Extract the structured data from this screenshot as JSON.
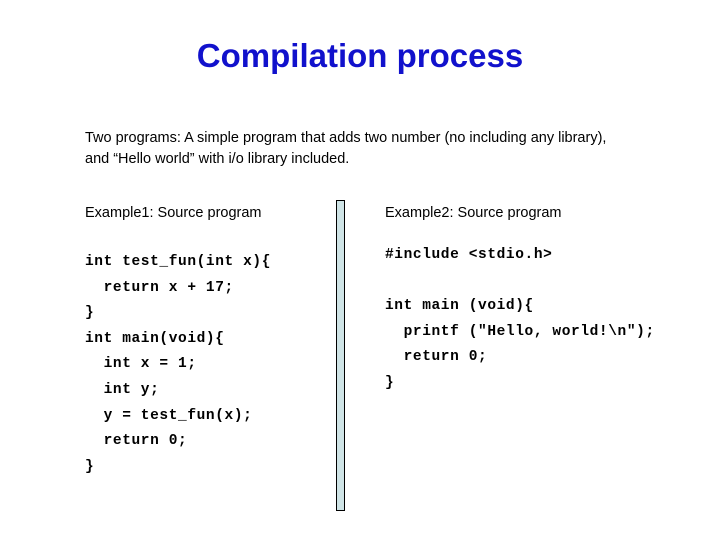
{
  "slide": {
    "title": "Compilation process",
    "title_color": "#1111cc",
    "background_color": "#ffffff",
    "intro": "Two programs: A simple program that adds two number (no including any library), and “Hello world” with i/o library included."
  },
  "divider": {
    "name": "vertical-divider-bar",
    "fill_color": "#cfe4e6",
    "border_color": "#000000"
  },
  "columns": {
    "left": {
      "header": "Example1: Source program",
      "code_lines": [
        "int test_fun(int x){",
        "  return x + 17;",
        "}",
        "int main(void){",
        "  int x = 1;",
        "  int y;",
        "  y = test_fun(x);",
        "  return 0;",
        "}"
      ]
    },
    "right": {
      "header": "Example2: Source program",
      "code_lines": [
        "#include <stdio.h>",
        "",
        "int main (void){",
        "  printf (\"Hello, world!\\n\");",
        "  return 0;",
        "}"
      ]
    }
  }
}
